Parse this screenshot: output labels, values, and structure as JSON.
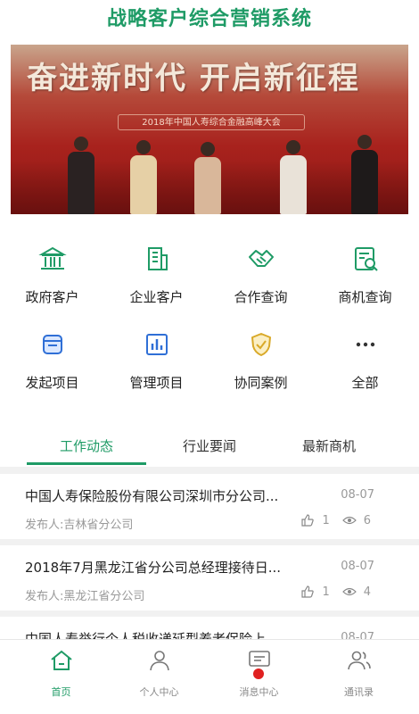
{
  "app": {
    "title": "战略客户综合营销系统"
  },
  "banner": {
    "slogan": "奋进新时代  开启新征程",
    "subline": "2018年中国人寿综合金融高峰大会"
  },
  "grid": [
    {
      "label": "政府客户",
      "icon": "government-building-icon"
    },
    {
      "label": "企业客户",
      "icon": "office-building-icon"
    },
    {
      "label": "合作查询",
      "icon": "handshake-icon"
    },
    {
      "label": "商机查询",
      "icon": "document-search-icon"
    },
    {
      "label": "发起项目",
      "icon": "project-box-icon"
    },
    {
      "label": "管理项目",
      "icon": "bar-chart-icon"
    },
    {
      "label": "协同案例",
      "icon": "shield-case-icon"
    },
    {
      "label": "全部",
      "icon": "more-dots-icon"
    }
  ],
  "tabs": [
    {
      "label": "工作动态",
      "active": true
    },
    {
      "label": "行业要闻",
      "active": false
    },
    {
      "label": "最新商机",
      "active": false
    }
  ],
  "news": [
    {
      "title": "中国人寿保险股份有限公司深圳市分公司...",
      "date": "08-07",
      "publisher": "发布人:吉林省分公司",
      "likes": "1",
      "views": "6"
    },
    {
      "title": "2018年7月黑龙江省分公司总经理接待日...",
      "date": "08-07",
      "publisher": "发布人:黑龙江省分公司",
      "likes": "1",
      "views": "4"
    },
    {
      "title": "中国人寿举行个人税收递延型养老保险上",
      "date": "08-07",
      "publisher": "",
      "likes": "",
      "views": ""
    }
  ],
  "nav": [
    {
      "label": "首页",
      "icon": "home-icon",
      "active": true
    },
    {
      "label": "个人中心",
      "icon": "user-icon",
      "active": false
    },
    {
      "label": "消息中心",
      "icon": "message-icon",
      "active": false,
      "badge": true
    },
    {
      "label": "通讯录",
      "icon": "contacts-icon",
      "active": false
    }
  ],
  "colors": {
    "accent": "#1f9b66",
    "banner": "#a8221d",
    "badge": "#e02020"
  }
}
